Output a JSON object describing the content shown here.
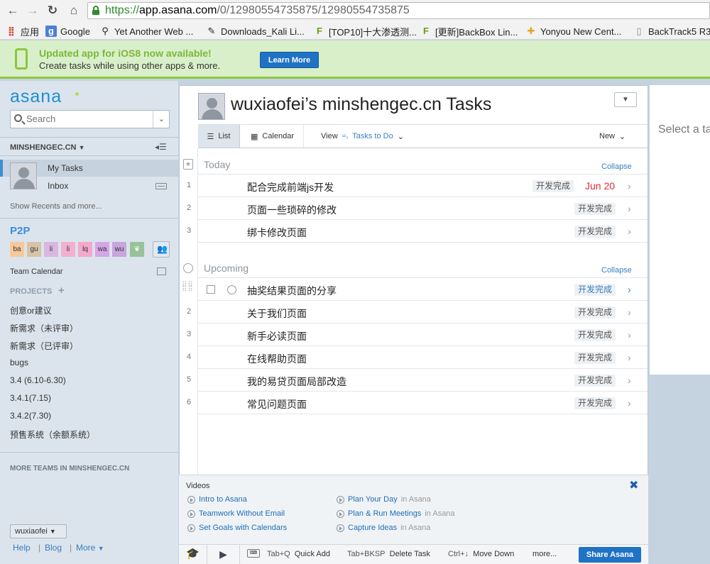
{
  "browser": {
    "url_scheme": "https://",
    "url_host": "app.asana.com",
    "url_path": "/0/12980554735875/12980554735875",
    "bookmarks": [
      {
        "icon": "apps-icon",
        "label": "应用"
      },
      {
        "icon": "google-icon",
        "label": "Google"
      },
      {
        "icon": "search-page-icon",
        "label": "Yet Another Web ..."
      },
      {
        "icon": "tools-icon",
        "label": "Downloads_Kali Li..."
      },
      {
        "icon": "feed-icon",
        "label": "[TOP10]十大渗透测..."
      },
      {
        "icon": "feed-icon",
        "label": "[更新]BackBox Lin..."
      },
      {
        "icon": "yonyou-icon",
        "label": "Yonyou New Cent..."
      },
      {
        "icon": "page-icon",
        "label": "BackTrack5 R3..."
      }
    ]
  },
  "banner": {
    "title": "Updated app for iOS8 now available!",
    "subtitle": "Create tasks while using other apps & more.",
    "button": "Learn More"
  },
  "sidebar": {
    "logo": "asana",
    "search_placeholder": "Search",
    "org": "MINSHENGEC.CN",
    "my_tasks": "My Tasks",
    "inbox": "Inbox",
    "recents": "Show Recents and more...",
    "team": "P2P",
    "members": [
      {
        "initials": "ba",
        "color": "#f7c89b"
      },
      {
        "initials": "gu",
        "color": "#d8c3a6"
      },
      {
        "initials": "li",
        "color": "#d8b8e0"
      },
      {
        "initials": "li",
        "color": "#f1b0d2"
      },
      {
        "initials": "lq",
        "color": "#f3a8cc"
      },
      {
        "initials": "wa",
        "color": "#d5a6e6"
      },
      {
        "initials": "wu",
        "color": "#c8a6dd"
      }
    ],
    "team_calendar": "Team Calendar",
    "projects_header": "PROJECTS",
    "projects": [
      "创意or建议",
      "新需求（未评审）",
      "新需求（已评审）",
      "bugs",
      "3.4 (6.10-6.30)",
      "3.4.1(7.15)",
      "3.4.2(7.30)",
      "预售系统（余额系统）"
    ],
    "more_teams": "MORE TEAMS IN MINSHENGEC.CN",
    "user": "wuxiaofei",
    "footer": [
      "Help",
      "Blog",
      "More"
    ]
  },
  "main": {
    "title": "wuxiaofei’s minshengec.cn Tasks",
    "tab_list": "List",
    "tab_calendar": "Calendar",
    "view_label": "View",
    "view_value": "Tasks to Do",
    "new_label": "New",
    "today_label": "Today",
    "upcoming_label": "Upcoming",
    "collapse_label": "Collapse",
    "today_tasks": [
      {
        "num": "1",
        "name": "配合完成前端js开发",
        "tag": "开发完成",
        "date": "Jun 20"
      },
      {
        "num": "2",
        "name": "页面一些琐碎的修改",
        "tag": "开发完成",
        "date": ""
      },
      {
        "num": "3",
        "name": "绑卡修改页面",
        "tag": "开发完成",
        "date": ""
      }
    ],
    "upcoming_tasks": [
      {
        "num": "",
        "name": "抽奖结果页面的分享",
        "tag": "开发完成"
      },
      {
        "num": "2",
        "name": "关于我们页面",
        "tag": "开发完成"
      },
      {
        "num": "3",
        "name": "新手必读页面",
        "tag": "开发完成"
      },
      {
        "num": "4",
        "name": "在线帮助页面",
        "tag": "开发完成"
      },
      {
        "num": "5",
        "name": "我的易贷页面局部改造",
        "tag": "开发完成"
      },
      {
        "num": "6",
        "name": "常见问题页面",
        "tag": "开发完成"
      }
    ],
    "right_pane": "Select a task"
  },
  "videos": {
    "header": "Videos",
    "items": [
      {
        "title": "Intro to Asana",
        "suffix": ""
      },
      {
        "title": "Teamwork Without Email",
        "suffix": ""
      },
      {
        "title": "Set Goals with Calendars",
        "suffix": ""
      },
      {
        "title": "Plan Your Day",
        "suffix": "in Asana"
      },
      {
        "title": "Plan & Run Meetings",
        "suffix": "in Asana"
      },
      {
        "title": "Capture Ideas",
        "suffix": "in Asana"
      }
    ]
  },
  "shortcuts": {
    "quick_add_key": "Tab+Q",
    "quick_add": "Quick Add",
    "delete_key": "Tab+BKSP",
    "delete": "Delete Task",
    "move_key": "Ctrl+↓",
    "move": "Move Down",
    "more": "more...",
    "share": "Share Asana"
  }
}
